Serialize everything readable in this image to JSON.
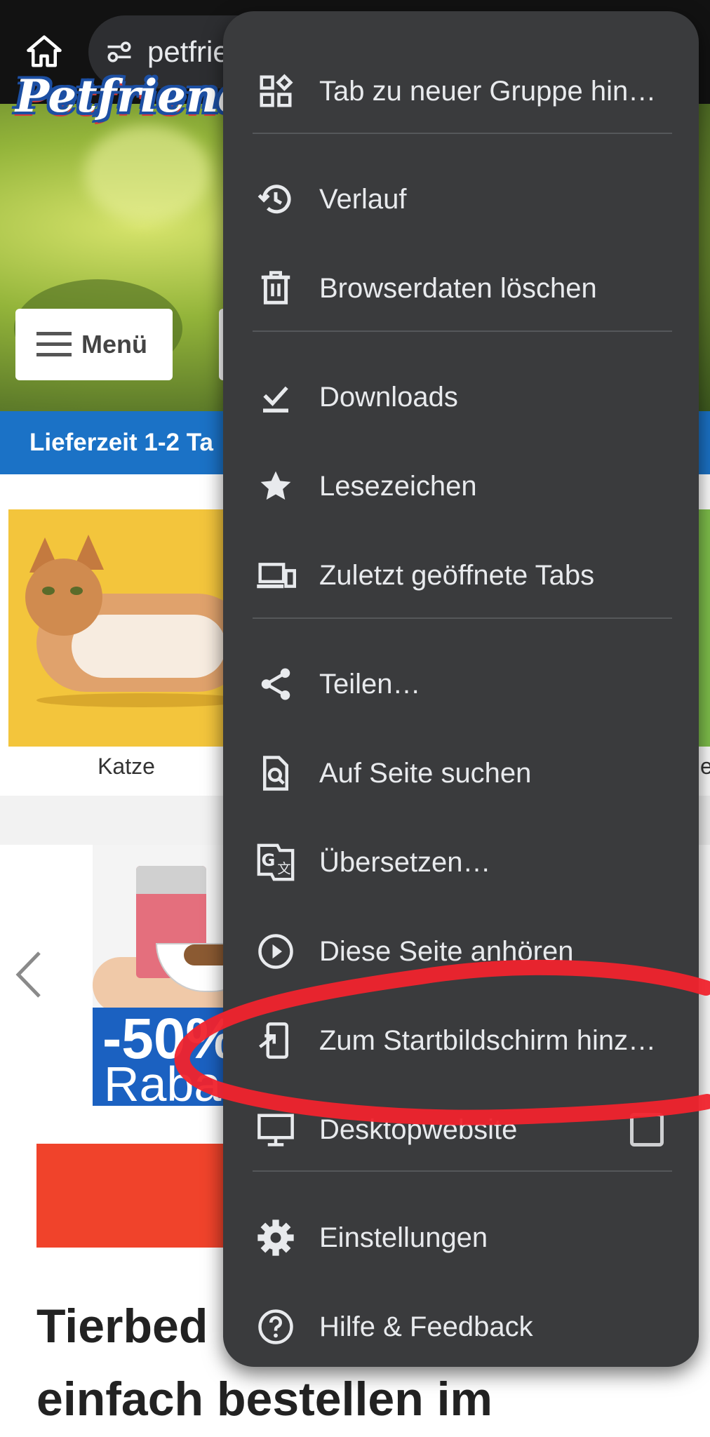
{
  "browser": {
    "url_text": "petfrie"
  },
  "page": {
    "logo_text": "Petfriend",
    "menu_label": "Menü",
    "ribbon_text": "Lieferzeit 1-2 Ta",
    "category": {
      "label": "Katze"
    },
    "right_partial_label": "e",
    "promo": {
      "percent": "-50%",
      "rabatt": "Raba"
    },
    "headline_line1": "Tierbed",
    "headline_line2": "einfach bestellen im"
  },
  "menu": {
    "items": [
      {
        "label": "Tab zu neuer Gruppe hin…",
        "icon": "add-to-group-icon"
      },
      {
        "label": "Verlauf",
        "icon": "history-icon"
      },
      {
        "label": "Browserdaten löschen",
        "icon": "trash-icon"
      },
      {
        "label": "Downloads",
        "icon": "download-done-icon"
      },
      {
        "label": "Lesezeichen",
        "icon": "star-icon"
      },
      {
        "label": "Zuletzt geöffnete Tabs",
        "icon": "devices-icon"
      },
      {
        "label": "Teilen…",
        "icon": "share-icon"
      },
      {
        "label": "Auf Seite suchen",
        "icon": "find-in-page-icon"
      },
      {
        "label": "Übersetzen…",
        "icon": "translate-icon"
      },
      {
        "label": "Diese Seite anhören",
        "icon": "play-circle-icon"
      },
      {
        "label": "Zum Startbildschirm hinz…",
        "icon": "add-to-home-screen-icon"
      },
      {
        "label": "Desktopwebsite",
        "icon": "desktop-icon",
        "checked": false
      },
      {
        "label": "Einstellungen",
        "icon": "gear-icon"
      },
      {
        "label": "Hilfe & Feedback",
        "icon": "help-icon"
      }
    ]
  },
  "colors": {
    "menu_bg": "#3a3b3d",
    "menu_text": "#e8eaed",
    "annotation": "#f0232d",
    "ribbon": "#1b72c6",
    "cta": "#f0432b"
  }
}
